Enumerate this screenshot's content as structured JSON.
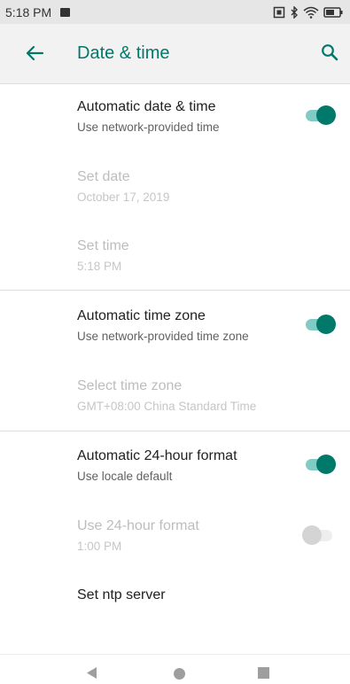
{
  "status_bar": {
    "time": "5:18 PM"
  },
  "app_bar": {
    "title": "Date & time"
  },
  "settings": {
    "auto_date_time": {
      "title": "Automatic date & time",
      "summary": "Use network-provided time",
      "enabled": true
    },
    "set_date": {
      "title": "Set date",
      "summary": "October 17, 2019"
    },
    "set_time": {
      "title": "Set time",
      "summary": "5:18 PM"
    },
    "auto_time_zone": {
      "title": "Automatic time zone",
      "summary": "Use network-provided time zone",
      "enabled": true
    },
    "select_time_zone": {
      "title": "Select time zone",
      "summary": "GMT+08:00 China Standard Time"
    },
    "auto_24h": {
      "title": "Automatic 24-hour format",
      "summary": "Use locale default",
      "enabled": true
    },
    "use_24h": {
      "title": "Use 24-hour format",
      "summary": "1:00 PM",
      "enabled": false
    },
    "ntp": {
      "title": "Set ntp server"
    }
  },
  "colors": {
    "accent": "#00796b",
    "accent_track": "#80cbc4",
    "appbar_bg": "#f2f2f2",
    "statusbar_bg": "#e6e6e6"
  }
}
